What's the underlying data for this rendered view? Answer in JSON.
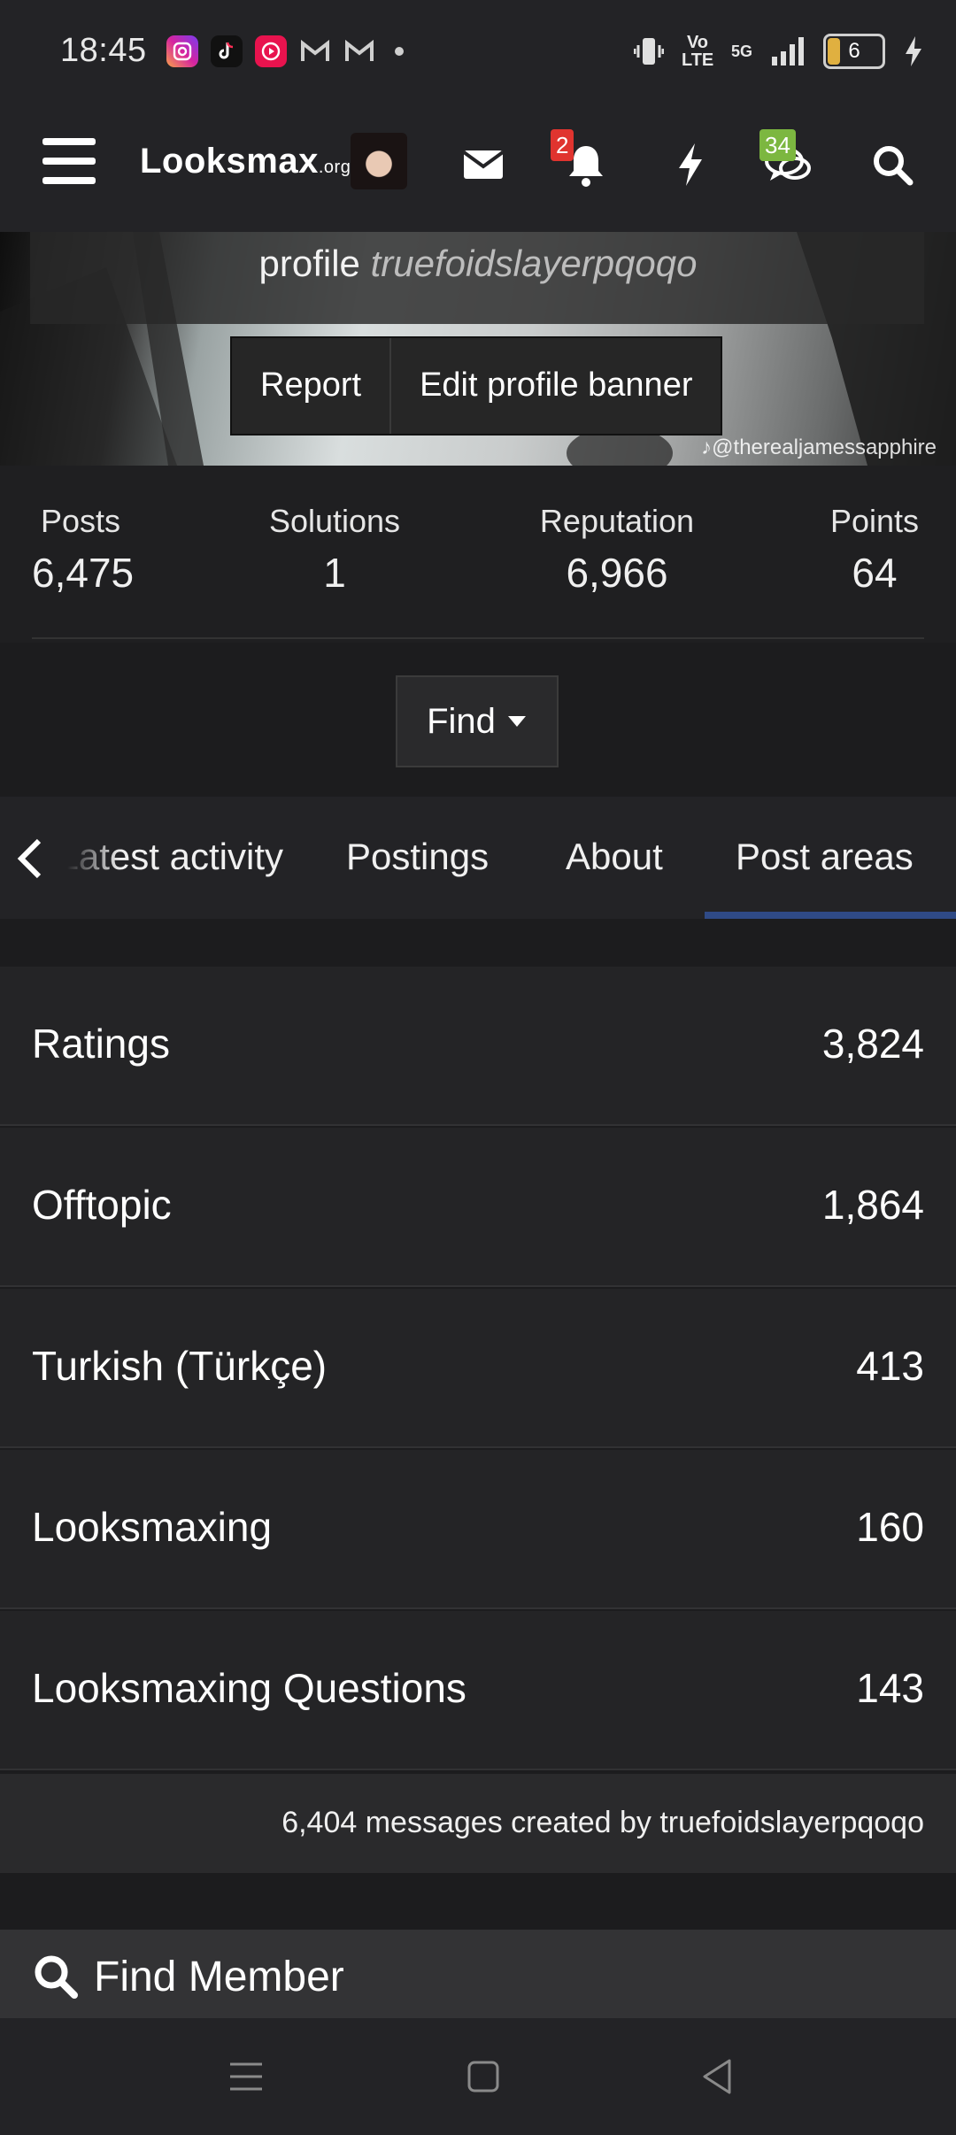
{
  "status_bar": {
    "time": "18:45",
    "network": "5G",
    "volte": "Vo LTE",
    "battery": "6",
    "app_icons": [
      "instagram-icon",
      "tiktok-icon",
      "youtube-music-icon",
      "gmail-icon",
      "gmail-icon"
    ]
  },
  "header": {
    "logo": "Looksmax",
    "logo_suffix": ".org",
    "notifications_badge": "2",
    "conversations_badge": "34",
    "colors": {
      "notifications_badge": "#e0342f",
      "conversations_badge": "#7cb740"
    }
  },
  "banner": {
    "profile_prefix": "profile",
    "username": "truefoidslayerpqoqo",
    "report_label": "Report",
    "edit_banner_label": "Edit profile banner",
    "watermark": "@therealjamessapphire"
  },
  "stats": [
    {
      "label": "Posts",
      "value": "6,475"
    },
    {
      "label": "Solutions",
      "value": "1"
    },
    {
      "label": "Reputation",
      "value": "6,966"
    },
    {
      "label": "Points",
      "value": "64"
    }
  ],
  "find_label": "Find",
  "tabs": {
    "items": [
      {
        "label": "Latest activity"
      },
      {
        "label": "Postings"
      },
      {
        "label": "About"
      },
      {
        "label": "Post areas"
      }
    ],
    "active": "Post areas",
    "accent": "#2f4a86"
  },
  "post_areas": [
    {
      "name": "Ratings",
      "count": "3,824"
    },
    {
      "name": "Offtopic",
      "count": "1,864"
    },
    {
      "name": "Turkish (Türkçe)",
      "count": "413"
    },
    {
      "name": "Looksmaxing",
      "count": "160"
    },
    {
      "name": "Looksmaxing Questions",
      "count": "143"
    }
  ],
  "messages_note": "6,404 messages created by truefoidslayerpqoqo",
  "find_member_label": "Find Member"
}
